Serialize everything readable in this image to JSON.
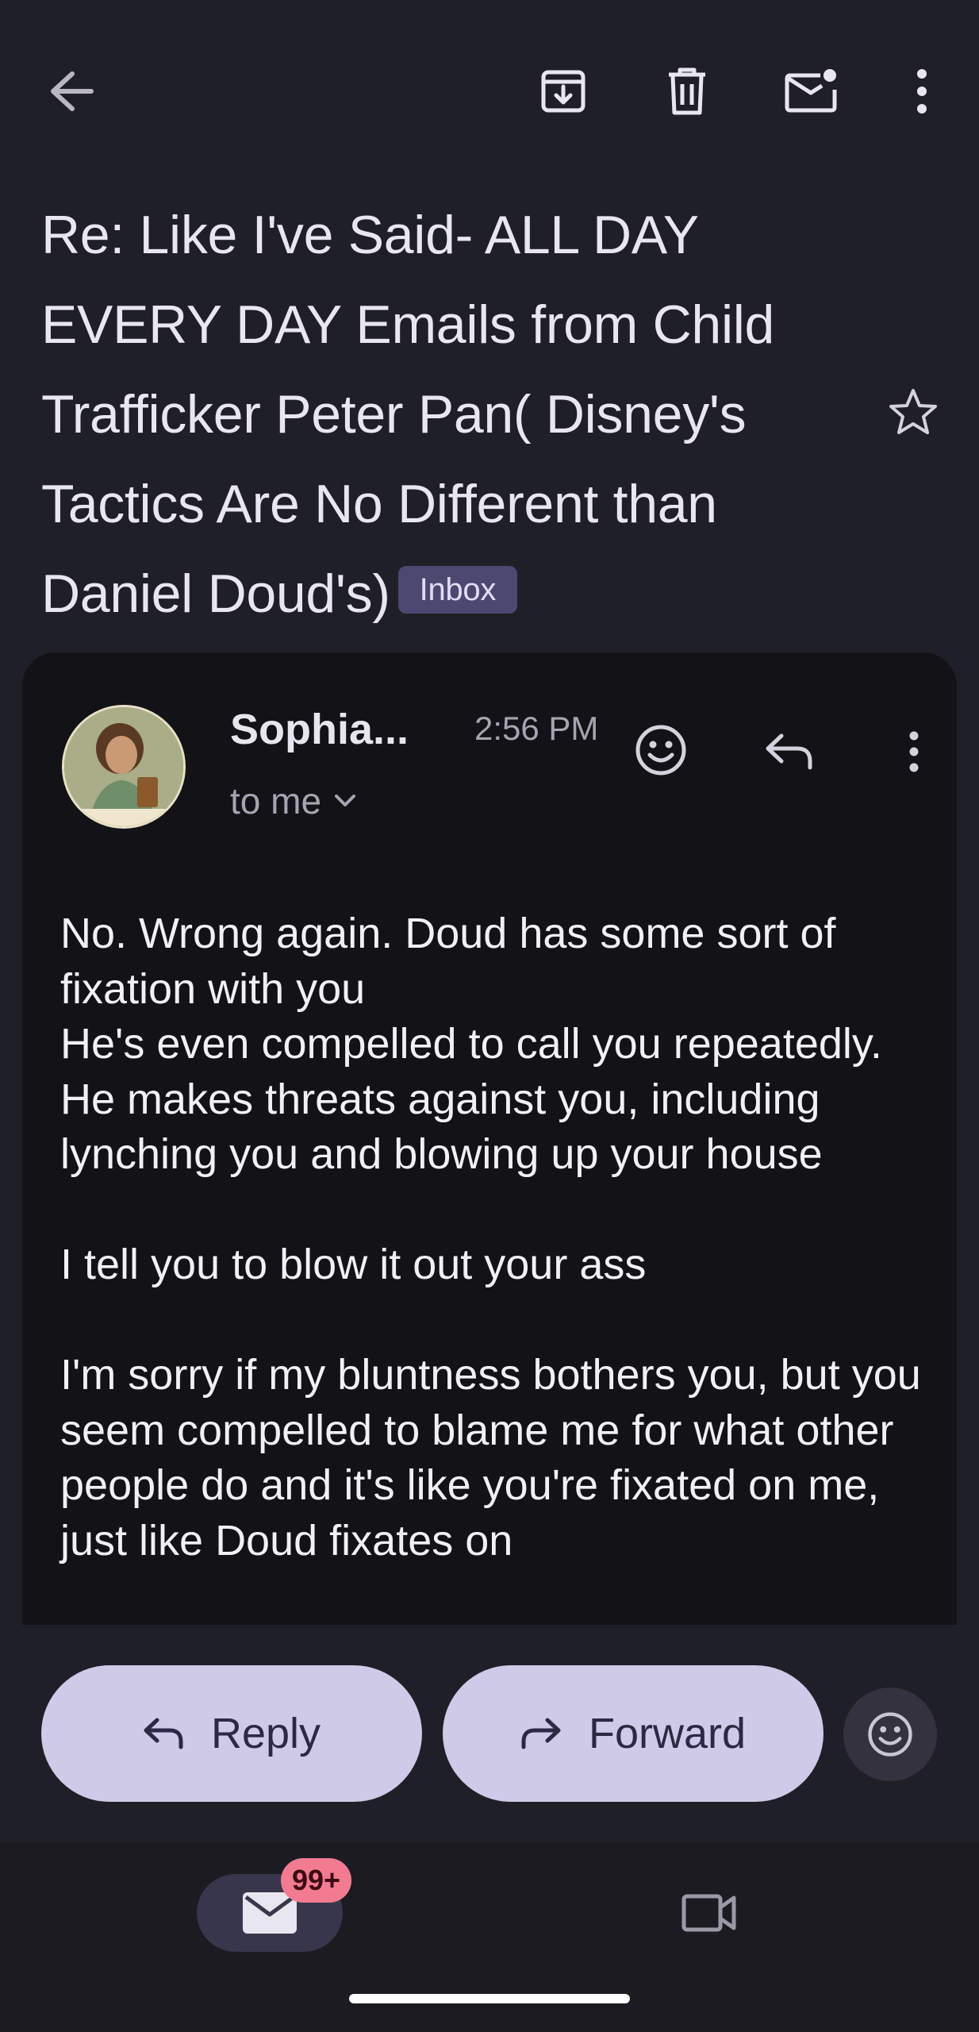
{
  "toolbar": {
    "back_icon": "arrow-back-icon",
    "archive_icon": "archive-icon",
    "delete_icon": "trash-icon",
    "mark_unread_icon": "mark-unread-icon",
    "more_icon": "more-vert-icon"
  },
  "subject": {
    "text": "Re: Like I've Said- ALL DAY EVERY DAY Emails from Child Trafficker Peter Pan( Disney's Tactics Are No Different than Daniel Doud's)",
    "label": "Inbox",
    "star_icon": "star-outline-icon"
  },
  "message": {
    "sender": "Sophia...",
    "time": "2:56 PM",
    "recipient": "to me",
    "body": "No. Wrong again. Doud has some sort of fixation with you\nHe's even compelled to call you repeatedly. He makes threats against you, including lynching you and blowing up your house\n\nI tell you to blow it out your ass\n\nI'm sorry if my bluntness bothers you, but you seem compelled to blame me for what other people do and it's like you're fixated on me, just like Doud fixates on"
  },
  "actions": {
    "reply_label": "Reply",
    "forward_label": "Forward"
  },
  "bottom_nav": {
    "mail_badge": "99+"
  },
  "colors": {
    "background": "#1f1f27",
    "card": "#121217",
    "pill": "#d0cae9",
    "chip": "#4d4870",
    "badge": "#f27b91"
  }
}
